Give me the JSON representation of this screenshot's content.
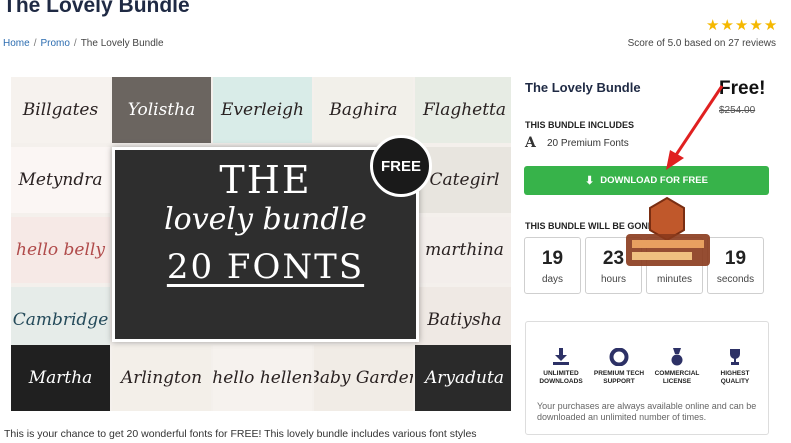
{
  "header": {
    "title": "The Lovely Bundle",
    "rating_text": "Score of 5.0 based on 27 reviews",
    "stars": 5
  },
  "breadcrumb": {
    "home": "Home",
    "promo": "Promo",
    "current": "The Lovely Bundle",
    "separator": "/"
  },
  "preview": {
    "tiles": [
      "Billgates",
      "Yolistha",
      "Everleigh",
      "Baghira",
      "Flaghetta",
      "Metyndra",
      "Categirl",
      "hello belly",
      "marthina",
      "Cambridge",
      "Batiysha",
      "Martha",
      "Arlington",
      "hello hellen",
      "Baby Garden",
      "Aryaduta"
    ],
    "center_line1": "THE",
    "center_line2": "lovely bundle",
    "center_line3": "20 FONTS",
    "badge": "FREE"
  },
  "caption": "This is your chance to get 20 wonderful fonts for FREE! This lovely bundle includes various font styles",
  "sidebar": {
    "title": "The Lovely Bundle",
    "price": "Free!",
    "old_price": "$254.00",
    "includes_heading": "THIS BUNDLE INCLUDES",
    "includes_icon": "A",
    "includes_text": "20 Premium Fonts",
    "download_label": "DOWNLOAD FOR FREE",
    "ends_heading": "THIS BUNDLE WILL BE GONE",
    "countdown": [
      {
        "value": "19",
        "unit": "days"
      },
      {
        "value": "23",
        "unit": "hours"
      },
      {
        "value": "",
        "unit": "minutes"
      },
      {
        "value": "19",
        "unit": "seconds"
      }
    ],
    "features": [
      {
        "icon": "download-icon",
        "label": "UNLIMITED DOWNLOADS"
      },
      {
        "icon": "lifebuoy-icon",
        "label": "PREMIUM TECH SUPPORT"
      },
      {
        "icon": "medal-icon",
        "label": "COMMERCIAL LICENSE"
      },
      {
        "icon": "trophy-icon",
        "label": "HIGHEST QUALITY"
      }
    ],
    "features_note": "Your purchases are always available online and can be downloaded an unlimited number of times."
  },
  "colors": {
    "accent_green": "#37b34a",
    "star": "#f5b800",
    "arrow_red": "#e02020"
  }
}
